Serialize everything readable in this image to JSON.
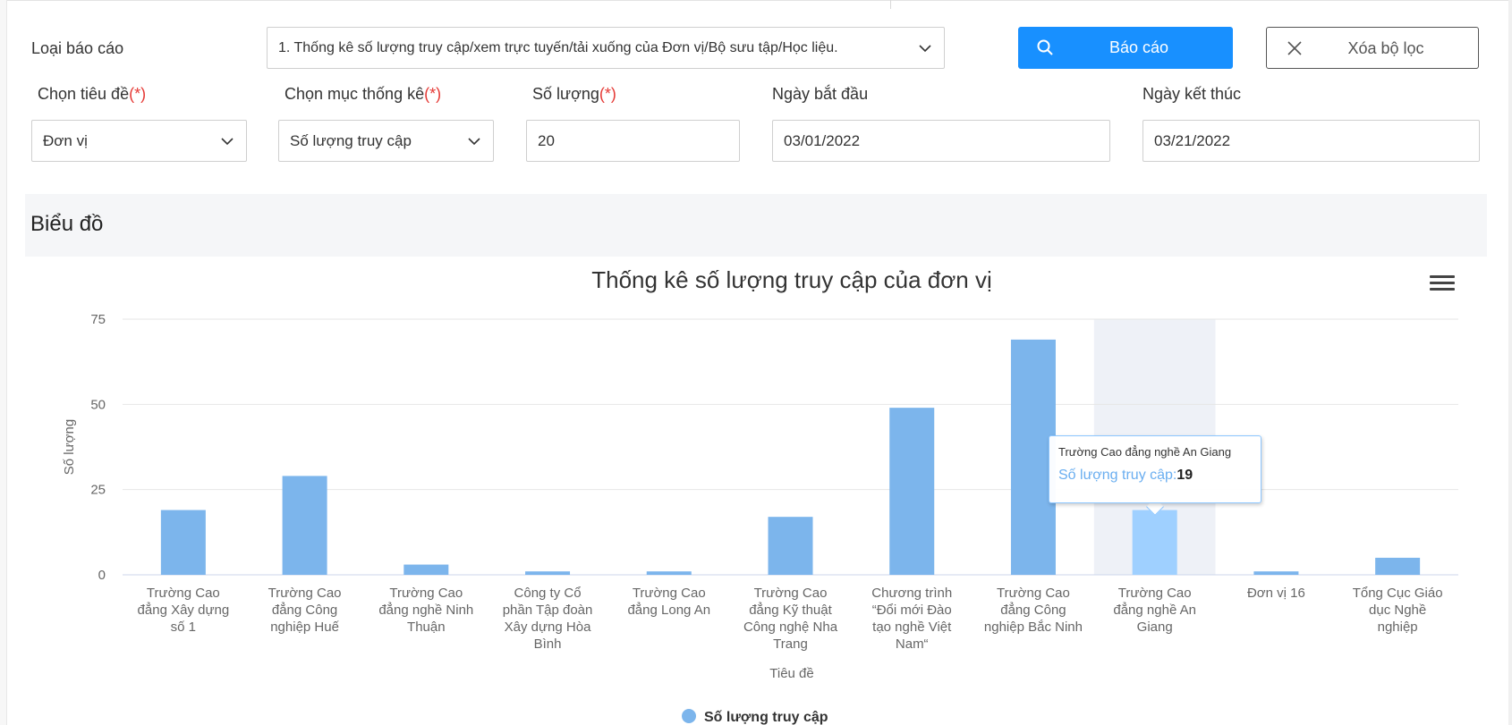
{
  "filters": {
    "report_type_label": "Loại báo cáo",
    "report_type_value": "1. Thống kê số lượng truy cập/xem trực tuyến/tải xuống của Đơn vị/Bộ sưu tập/Học liệu.",
    "report_button": "Báo cáo",
    "clear_button": "Xóa bộ lọc",
    "title_label": "Chọn tiêu đề",
    "title_value": "Đơn vị",
    "stat_label": "Chọn mục thống kê",
    "stat_value": "Số lượng truy cập",
    "quantity_label": "Số lượng",
    "quantity_value": "20",
    "start_label": "Ngày bắt đầu",
    "start_value": "03/01/2022",
    "end_label": "Ngày kết thúc",
    "end_value": "03/21/2022",
    "required_mark": "(*)"
  },
  "section": {
    "title": "Biểu đồ"
  },
  "colors": {
    "primary": "#1890ff",
    "bar": "#7cb5ec",
    "bar_hover": "#9fd0ff",
    "required": "#e53935"
  },
  "chart_data": {
    "type": "bar",
    "title": "Thống kê số lượng truy cập của đơn vị",
    "xlabel": "Tiêu đề",
    "ylabel": "Số lượng",
    "ylim": [
      0,
      75
    ],
    "yticks": [
      "0",
      "25",
      "50",
      "75"
    ],
    "grid": true,
    "legend_position": "bottom",
    "categories": [
      [
        "Trường Cao",
        "đẳng Xây dựng",
        "số 1"
      ],
      [
        "Trường Cao",
        "đẳng Công",
        "nghiệp Huế"
      ],
      [
        "Trường Cao",
        "đẳng nghề Ninh",
        "Thuận"
      ],
      [
        "Công ty Cổ",
        "phần Tập đoàn",
        "Xây dựng Hòa",
        "Bình"
      ],
      [
        "Trường Cao",
        "đẳng Long An"
      ],
      [
        "Trường Cao",
        "đẳng Kỹ thuật",
        "Công nghệ Nha",
        "Trang"
      ],
      [
        "Chương trình",
        "“Đổi mới Đào",
        "tạo nghề Việt",
        "Nam“"
      ],
      [
        "Trường Cao",
        "đẳng Công",
        "nghiệp Bắc Ninh"
      ],
      [
        "Trường Cao",
        "đẳng nghề An",
        "Giang"
      ],
      [
        "Đơn vị 16"
      ],
      [
        "Tổng Cục Giáo",
        "dục Nghề",
        "nghiệp"
      ]
    ],
    "series": [
      {
        "name": "Số lượng truy cập",
        "values": [
          19,
          29,
          3,
          1,
          1,
          17,
          49,
          69,
          19,
          1,
          5
        ]
      }
    ],
    "highlighted_index": 8,
    "tooltip": {
      "title": "Trường Cao đẳng nghề An Giang",
      "label": "Số lượng truy cập:",
      "value": "19"
    }
  }
}
